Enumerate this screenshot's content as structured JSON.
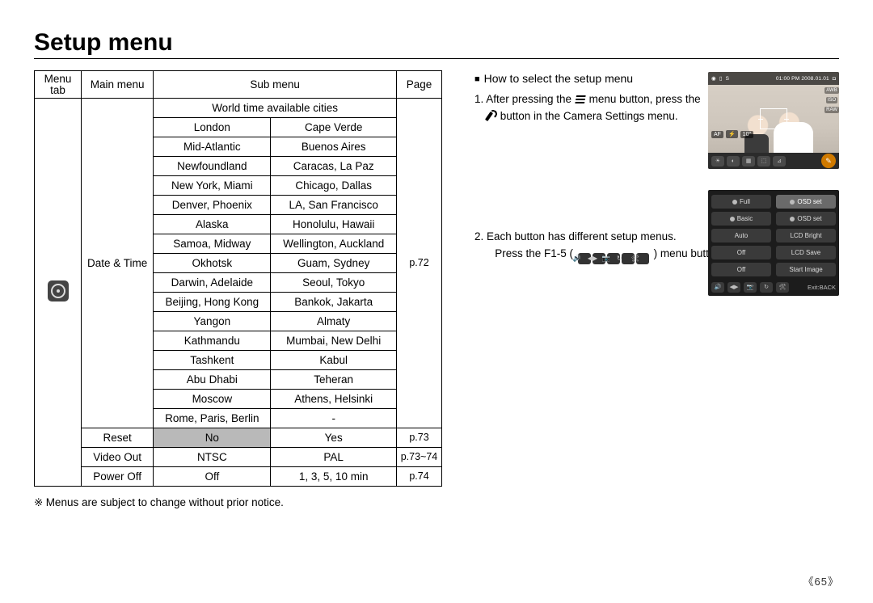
{
  "title": "Setup menu",
  "table": {
    "headers": {
      "menutab": "Menu tab",
      "mainmenu": "Main menu",
      "submenu": "Sub menu",
      "page": "Page"
    },
    "worldtime_header": "World time available cities",
    "mainmenu_datetime": "Date & Time",
    "page_datetime": "p.72",
    "city_rows": [
      [
        "London",
        "Cape Verde"
      ],
      [
        "Mid-Atlantic",
        "Buenos Aires"
      ],
      [
        "Newfoundland",
        "Caracas, La Paz"
      ],
      [
        "New York, Miami",
        "Chicago, Dallas"
      ],
      [
        "Denver, Phoenix",
        "LA, San Francisco"
      ],
      [
        "Alaska",
        "Honolulu, Hawaii"
      ],
      [
        "Samoa, Midway",
        "Wellington, Auckland"
      ],
      [
        "Okhotsk",
        "Guam, Sydney"
      ],
      [
        "Darwin, Adelaide",
        "Seoul, Tokyo"
      ],
      [
        "Beijing, Hong Kong",
        "Bankok, Jakarta"
      ],
      [
        "Yangon",
        "Almaty"
      ],
      [
        "Kathmandu",
        "Mumbai, New Delhi"
      ],
      [
        "Tashkent",
        "Kabul"
      ],
      [
        "Abu Dhabi",
        "Teheran"
      ],
      [
        "Moscow",
        "Athens, Helsinki"
      ],
      [
        "Rome, Paris, Berlin",
        "-"
      ]
    ],
    "extra_rows": [
      {
        "main": "Reset",
        "s1": "No",
        "s2": "Yes",
        "page": "p.73",
        "shaded1": true
      },
      {
        "main": "Video Out",
        "s1": "NTSC",
        "s2": "PAL",
        "page": "p.73~74"
      },
      {
        "main": "Power Off",
        "s1": "Off",
        "s2": "1, 3, 5, 10 min",
        "page": "p.74"
      }
    ]
  },
  "footnote": "Menus are subject to change without prior notice.",
  "howto": {
    "heading": "How to select the setup menu",
    "step1a": "1. After pressing the",
    "step1b": "menu button, press the",
    "step1c": "button in the Camera Settings menu.",
    "step2a": "2. Each button has different setup menus.",
    "step2b": "Press the F1-5 (",
    "step2c": ") menu button."
  },
  "cam": {
    "topbar_time": "01:00 PM 2008.01.01",
    "side": [
      "AWB",
      "ISO",
      "RAW"
    ],
    "mid": [
      "AF",
      "⚡",
      "10''"
    ],
    "bot_icons": [
      "☀",
      "◐",
      "▦",
      "⬚",
      "⊿"
    ]
  },
  "settings": {
    "rows": [
      [
        {
          "t": "Full",
          "dot": true
        },
        {
          "t": "OSD set",
          "sel": true,
          "dot": true
        }
      ],
      [
        {
          "t": "Basic",
          "dot": true
        },
        {
          "t": "OSD set",
          "dot": true
        }
      ],
      [
        {
          "t": "Auto"
        },
        {
          "t": "LCD Bright"
        }
      ],
      [
        {
          "t": "Off"
        },
        {
          "t": "LCD Save"
        }
      ],
      [
        {
          "t": "Off"
        },
        {
          "t": "Start Image"
        }
      ]
    ],
    "footer_icons": [
      "🔊",
      "◀▶",
      "📷",
      "↻",
      "🛠"
    ],
    "footer_exit": "Exit:BACK"
  },
  "page_indicator": "《65》"
}
